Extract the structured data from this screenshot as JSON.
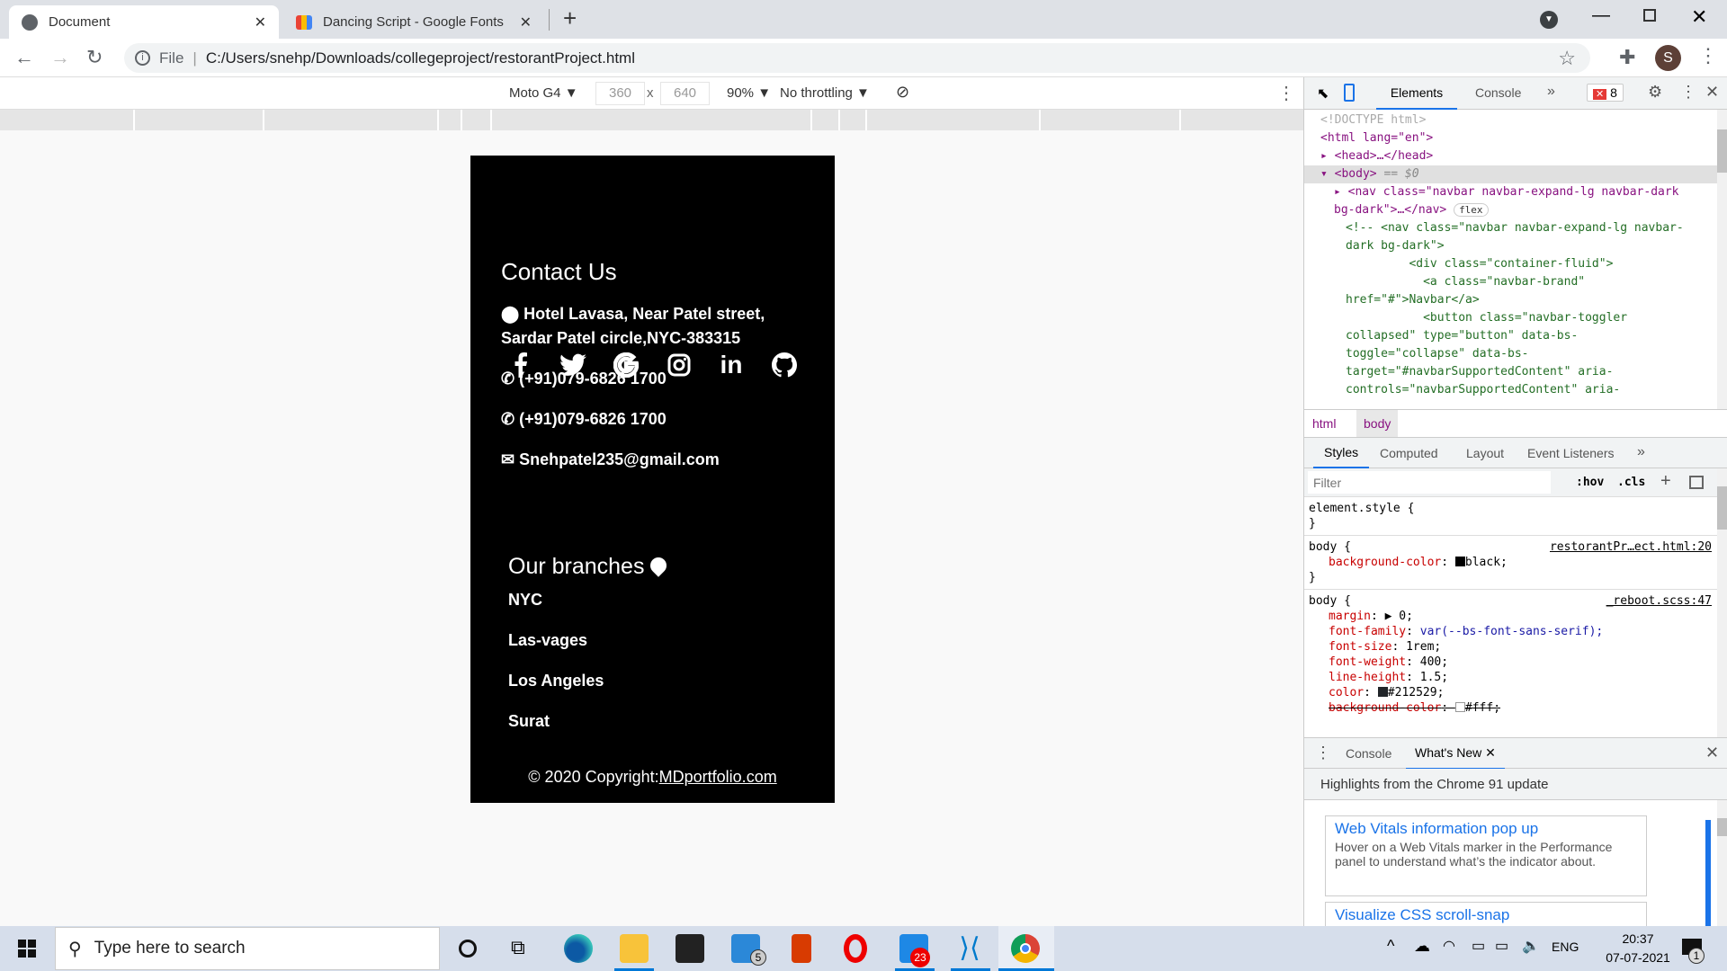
{
  "browser": {
    "tabs": [
      {
        "title": "Document",
        "active": true
      },
      {
        "title": "Dancing Script - Google Fonts",
        "active": false
      }
    ],
    "new_tab": "+",
    "url_scheme": "File",
    "url": "C:/Users/snehp/Downloads/collegeproject/restorantProject.html",
    "profile_initial": "S"
  },
  "device_toolbar": {
    "device": "Moto G4 ▼",
    "width": "360",
    "x": "x",
    "height": "640",
    "zoom": "90% ▼",
    "throttling": "No throttling ▼"
  },
  "page": {
    "social_icons": [
      "facebook-icon",
      "twitter-icon",
      "google-icon",
      "instagram-icon",
      "linkedin-icon",
      "github-icon"
    ],
    "contact_title": "Contact Us",
    "address_line1": "Hotel Lavasa, Near Patel street,",
    "address_line2": "Sardar Patel circle,NYC-383315",
    "phone1": "(+91)079-6826 1700",
    "phone2": "(+91)079-6826 1700",
    "email": "Snehpatel235@gmail.com",
    "branches_title": "Our branches",
    "branches": [
      "NYC",
      "Las-vages",
      "Los Angeles",
      "Surat"
    ],
    "copyright": "© 2020 Copyright:",
    "copyright_link": "MDportfolio.com"
  },
  "devtools": {
    "tabs": [
      "Elements",
      "Console"
    ],
    "more": "»",
    "error_count": "8",
    "dom": {
      "doctype": "<!DOCTYPE html>",
      "html_open": "<html lang=\"en\">",
      "head": "<head>…</head>",
      "body": "<body>",
      "body_suffix": " == $0",
      "nav1": "<nav class=\"navbar navbar-expand-lg navbar-dark",
      "nav2": "bg-dark\">…</nav>",
      "flex_badge": "flex",
      "comment": [
        "<!-- <nav class=\"navbar navbar-expand-lg navbar-",
        "dark bg-dark\">",
        "         <div class=\"container-fluid\">",
        "           <a class=\"navbar-brand\"",
        "href=\"#\">Navbar</a>",
        "           <button class=\"navbar-toggler",
        "collapsed\" type=\"button\" data-bs-",
        "toggle=\"collapse\" data-bs-",
        "target=\"#navbarSupportedContent\" aria-",
        "controls=\"navbarSupportedContent\" aria-"
      ]
    },
    "breadcrumbs": [
      "html",
      "body"
    ],
    "style_tabs": [
      "Styles",
      "Computed",
      "Layout",
      "Event Listeners"
    ],
    "filter_placeholder": "Filter",
    "hov": ":hov",
    "cls": ".cls",
    "plus": "+",
    "rules": {
      "element_style": "element.style {",
      "close": "}",
      "body1_sel": "body {",
      "body1_src": "restorantPr…ect.html:20",
      "body1_prop": "background-color",
      "body1_val": "black;",
      "body2_sel": "body {",
      "body2_src": "_reboot.scss:47",
      "body2_props": [
        [
          "margin",
          "▶ 0;"
        ],
        [
          "font-family",
          "var(--bs-font-sans-serif);"
        ],
        [
          "font-size",
          "1rem;"
        ],
        [
          "font-weight",
          "400;"
        ],
        [
          "line-height",
          "1.5;"
        ],
        [
          "color",
          "#212529;"
        ],
        [
          "background-color",
          "#fff;"
        ]
      ]
    },
    "drawer_tabs": [
      "Console",
      "What's New"
    ],
    "whatsnew_header": "Highlights from the Chrome 91 update",
    "cards": [
      {
        "title": "Web Vitals information pop up",
        "body": "Hover on a Web Vitals marker in the Performance panel to understand what’s the indicator about."
      },
      {
        "title": "Visualize CSS scroll-snap",
        "body": ""
      }
    ]
  },
  "taskbar": {
    "search_placeholder": "Type here to search",
    "mail_badge": "5",
    "whatsapp_badge": "23",
    "lang": "ENG",
    "time": "20:37",
    "date": "07-07-2021",
    "notif_count": "1"
  }
}
